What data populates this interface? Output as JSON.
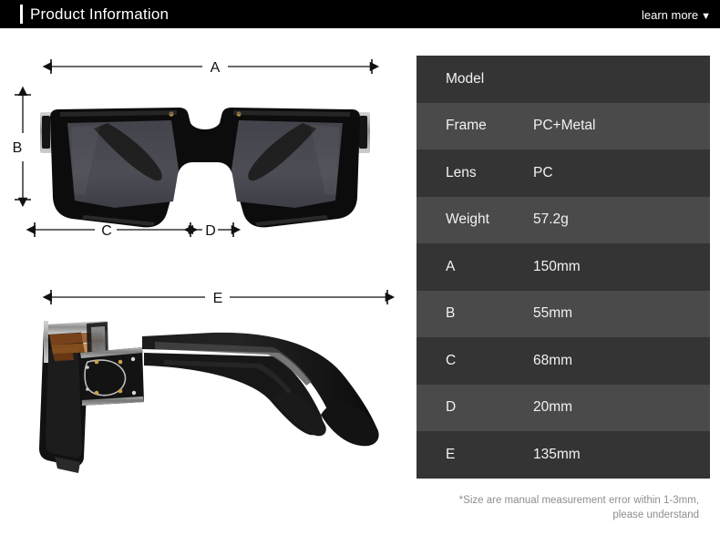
{
  "header": {
    "title": "Product Information",
    "learn_more": "learn more",
    "caret": "▼",
    "accent_color": "#ffffff",
    "background_color": "#000000"
  },
  "diagram": {
    "front_view": {
      "alt": "front view of black square sunglasses",
      "dimension_labels": [
        "A",
        "B",
        "C",
        "D"
      ]
    },
    "side_view": {
      "alt": "side view of black square sunglasses temple arm",
      "dimension_labels": [
        "E"
      ]
    },
    "labels": {
      "a": "A",
      "b": "B",
      "c": "C",
      "d": "D",
      "e": "E"
    },
    "lens_color": "#4b4b53",
    "frame_color": "#0d0d0d"
  },
  "spec_table": {
    "row_color_odd": "#343434",
    "row_color_even": "#4a4a4a",
    "rows": [
      {
        "label": "Model",
        "value": ""
      },
      {
        "label": "Frame",
        "value": "PC+Metal"
      },
      {
        "label": "Lens",
        "value": "PC"
      },
      {
        "label": "Weight",
        "value": "57.2g"
      },
      {
        "label": "A",
        "value": "150mm"
      },
      {
        "label": "B",
        "value": "55mm"
      },
      {
        "label": "C",
        "value": "68mm"
      },
      {
        "label": "D",
        "value": "20mm"
      },
      {
        "label": "E",
        "value": "135mm"
      }
    ],
    "note_line1": "*Size are manual measurement error within 1-3mm,",
    "note_line2": "please understand"
  }
}
